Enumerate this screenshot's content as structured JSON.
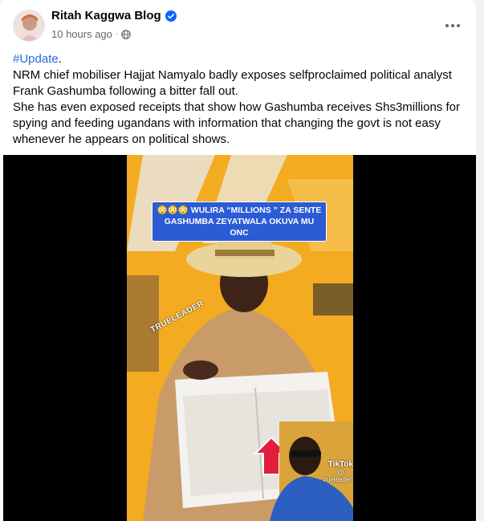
{
  "post": {
    "author": "Ritah Kaggwa Blog",
    "timestamp": "10 hours ago",
    "separator": "·",
    "hashtag": "#Update",
    "hashtag_suffix": ".",
    "paragraphs": [
      "NRM chief mobiliser Hajjat Namyalo badly exposes selfproclaimed political analyst Frank Gashumba following a bitter fall out.",
      "She has even exposed receipts that show how Gashumba receives Shs3millions for spying and feeding ugandans with information that changing the govt is not easy whenever he appears on political shows."
    ]
  },
  "video": {
    "caption": "😳😳😳 WULIRA “MILLIONS ” ZA SENTE GASHUMBA ZEYATWALA OKUVA MU ONC",
    "watermark": "TRUELEADER",
    "tiktok_label": "TikTok",
    "tiktok_handle": "@ trueleaderug"
  },
  "icons": {
    "verified": "verified-badge-icon",
    "privacy": "globe-icon",
    "more": "more-options-icon"
  },
  "colors": {
    "verified_blue": "#0866ff",
    "hashtag_blue": "#216fdb",
    "meta_gray": "#65676b",
    "caption_bg": "#2c5bd6"
  }
}
